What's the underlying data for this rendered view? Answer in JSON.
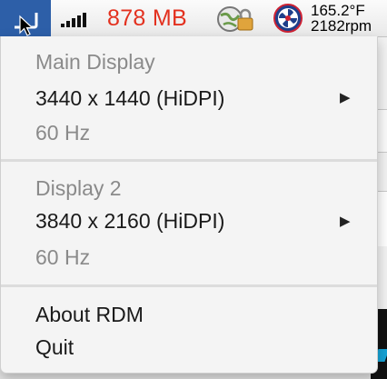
{
  "menubar": {
    "memory": "878 MB",
    "temperature": "165.2°F",
    "fan_speed": "2182rpm",
    "icons": [
      "rdm-display-icon",
      "signal-bars-icon",
      "vpn-lock-icon",
      "fan-icon"
    ]
  },
  "menu": {
    "display1": {
      "name": "Main Display",
      "resolution": "3440 x 1440 (HiDPI)",
      "refresh": "60 Hz"
    },
    "display2": {
      "name": "Display 2",
      "resolution": "3840 x 2160 (HiDPI)",
      "refresh": "60 Hz"
    },
    "about": "About RDM",
    "quit": "Quit",
    "submenu_arrow": "▶"
  }
}
